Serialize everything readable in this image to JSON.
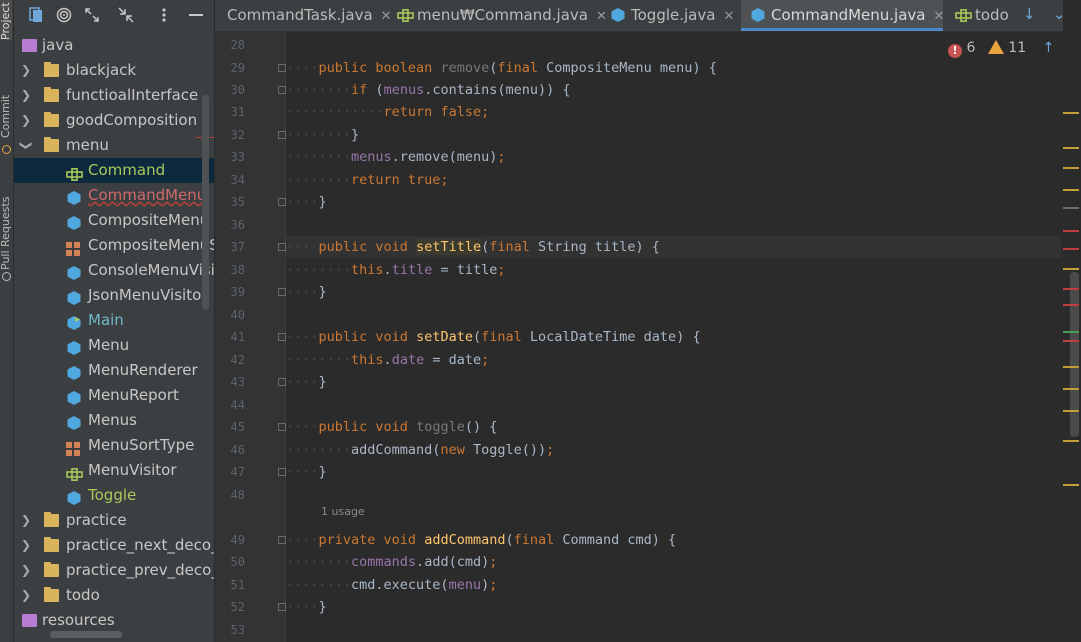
{
  "left_strip": {
    "items": [
      {
        "label": "Project",
        "active": true
      },
      {
        "label": "Commit",
        "active": false
      },
      {
        "label": "Pull Requests",
        "active": false
      }
    ]
  },
  "project_panel": {
    "toolbar": {
      "icons": [
        "project-files-icon",
        "target-icon",
        "expand-icon",
        "collapse-icon",
        "options-icon",
        "hide-icon"
      ]
    },
    "tree": [
      {
        "label": "java",
        "level": 0,
        "type": "source-folder",
        "expanded": true
      },
      {
        "label": "blackjack",
        "level": 1,
        "type": "folder",
        "expanded": false
      },
      {
        "label": "functioalInterface",
        "level": 1,
        "type": "folder",
        "expanded": false
      },
      {
        "label": "goodComposition",
        "level": 1,
        "type": "folder",
        "expanded": false
      },
      {
        "label": "menu",
        "level": 1,
        "type": "folder",
        "expanded": true
      },
      {
        "label": "Command",
        "level": 2,
        "type": "interface",
        "selected": true,
        "style": "green"
      },
      {
        "label": "CommandMenu",
        "level": 2,
        "type": "class",
        "style": "red"
      },
      {
        "label": "CompositeMenu",
        "level": 2,
        "type": "class"
      },
      {
        "label": "CompositeMenuSc",
        "level": 2,
        "type": "enum"
      },
      {
        "label": "ConsoleMenuVisito",
        "level": 2,
        "type": "class"
      },
      {
        "label": "JsonMenuVisitor",
        "level": 2,
        "type": "class"
      },
      {
        "label": "Main",
        "level": 2,
        "type": "main-class",
        "style": "teal"
      },
      {
        "label": "Menu",
        "level": 2,
        "type": "class"
      },
      {
        "label": "MenuRenderer",
        "level": 2,
        "type": "class"
      },
      {
        "label": "MenuReport",
        "level": 2,
        "type": "class"
      },
      {
        "label": "Menus",
        "level": 2,
        "type": "class"
      },
      {
        "label": "MenuSortType",
        "level": 2,
        "type": "enum"
      },
      {
        "label": "MenuVisitor",
        "level": 2,
        "type": "interface"
      },
      {
        "label": "Toggle",
        "level": 2,
        "type": "class",
        "style": "green"
      },
      {
        "label": "practice",
        "level": 1,
        "type": "folder",
        "expanded": false
      },
      {
        "label": "practice_next_deco_fo",
        "level": 1,
        "type": "folder",
        "expanded": false
      },
      {
        "label": "practice_prev_deco_fo",
        "level": 1,
        "type": "folder",
        "expanded": false
      },
      {
        "label": "todo",
        "level": 1,
        "type": "folder",
        "expanded": false
      },
      {
        "label": "resources",
        "level": 0,
        "type": "resources-folder",
        "expanded": false
      }
    ]
  },
  "tabs": [
    {
      "label": "CommandTask.java",
      "icon": "none",
      "active": false
    },
    {
      "label": "menu₩Command.java",
      "icon": "interface-icon",
      "active": false
    },
    {
      "label": "Toggle.java",
      "icon": "class-icon",
      "active": false
    },
    {
      "label": "CommandMenu.java",
      "icon": "class-icon",
      "active": true
    },
    {
      "label": "todo",
      "icon": "interface-icon",
      "active": false
    }
  ],
  "inspections": {
    "errors": "6",
    "warnings": "11"
  },
  "editor": {
    "lines": [
      {
        "n": "28",
        "code": []
      },
      {
        "n": "29",
        "code": [
          [
            "dots",
            "····"
          ],
          [
            "kw",
            "public boolean "
          ],
          [
            "mute",
            "remove"
          ],
          [
            "",
            "("
          ],
          [
            "kw",
            "final "
          ],
          [
            "",
            "CompositeMenu menu) {"
          ]
        ]
      },
      {
        "n": "30",
        "code": [
          [
            "dots",
            "········"
          ],
          [
            "kw",
            "if "
          ],
          [
            "",
            "("
          ],
          [
            "fld",
            "menus"
          ],
          [
            "",
            ".contains(menu)) {"
          ]
        ]
      },
      {
        "n": "31",
        "code": [
          [
            "dots",
            "············"
          ],
          [
            "kw",
            "return false;"
          ]
        ]
      },
      {
        "n": "32",
        "code": [
          [
            "dots",
            "········"
          ],
          [
            "",
            "}"
          ]
        ]
      },
      {
        "n": "33",
        "code": [
          [
            "dots",
            "········"
          ],
          [
            "fld",
            "menus"
          ],
          [
            "",
            ".remove(menu)"
          ],
          [
            "kw",
            ";"
          ]
        ]
      },
      {
        "n": "34",
        "code": [
          [
            "dots",
            "········"
          ],
          [
            "kw",
            "return true;"
          ]
        ]
      },
      {
        "n": "35",
        "code": [
          [
            "dots",
            "····"
          ],
          [
            "",
            "}"
          ]
        ]
      },
      {
        "n": "36",
        "code": []
      },
      {
        "n": "37",
        "code": [
          [
            "dots",
            "····"
          ],
          [
            "kw",
            "public void "
          ],
          [
            "fnhl",
            "setTitle"
          ],
          [
            "",
            "("
          ],
          [
            "kw",
            "final "
          ],
          [
            "",
            "String title) {"
          ]
        ],
        "caret": true
      },
      {
        "n": "38",
        "code": [
          [
            "dots",
            "········"
          ],
          [
            "kw",
            "this"
          ],
          [
            "",
            "."
          ],
          [
            "fld",
            "title"
          ],
          [
            "",
            " = title"
          ],
          [
            "kw",
            ";"
          ]
        ]
      },
      {
        "n": "39",
        "code": [
          [
            "dots",
            "····"
          ],
          [
            "",
            "}"
          ]
        ]
      },
      {
        "n": "40",
        "code": []
      },
      {
        "n": "41",
        "code": [
          [
            "dots",
            "····"
          ],
          [
            "kw",
            "public void "
          ],
          [
            "fn",
            "setDate"
          ],
          [
            "",
            "("
          ],
          [
            "kw",
            "final "
          ],
          [
            "",
            "LocalDateTime date) {"
          ]
        ]
      },
      {
        "n": "42",
        "code": [
          [
            "dots",
            "········"
          ],
          [
            "kw",
            "this"
          ],
          [
            "",
            "."
          ],
          [
            "fld",
            "date"
          ],
          [
            "",
            " = date"
          ],
          [
            "kw",
            ";"
          ]
        ]
      },
      {
        "n": "43",
        "code": [
          [
            "dots",
            "····"
          ],
          [
            "",
            "}"
          ]
        ]
      },
      {
        "n": "44",
        "code": []
      },
      {
        "n": "45",
        "code": [
          [
            "dots",
            "····"
          ],
          [
            "kw",
            "public void "
          ],
          [
            "mute",
            "toggle"
          ],
          [
            "",
            "() {"
          ]
        ]
      },
      {
        "n": "46",
        "code": [
          [
            "dots",
            "········"
          ],
          [
            "",
            "addCommand("
          ],
          [
            "kw",
            "new "
          ],
          [
            "",
            "Toggle())"
          ],
          [
            "kw",
            ";"
          ]
        ]
      },
      {
        "n": "47",
        "code": [
          [
            "dots",
            "····"
          ],
          [
            "",
            "}"
          ]
        ]
      },
      {
        "n": "48",
        "code": []
      },
      {
        "n": "49",
        "code": [
          [
            "dots",
            "····"
          ],
          [
            "kw",
            "private void "
          ],
          [
            "fn",
            "addCommand"
          ],
          [
            "",
            "("
          ],
          [
            "kw",
            "final "
          ],
          [
            "",
            "Command cmd) {"
          ]
        ],
        "usage": "1 usage"
      },
      {
        "n": "50",
        "code": [
          [
            "dots",
            "········"
          ],
          [
            "fld",
            "commands"
          ],
          [
            "",
            ".add(cmd)"
          ],
          [
            "kw",
            ";"
          ]
        ]
      },
      {
        "n": "51",
        "code": [
          [
            "dots",
            "········"
          ],
          [
            "",
            "cmd.execute("
          ],
          [
            "fld",
            "menu"
          ],
          [
            "",
            ")"
          ],
          [
            "kw",
            ";"
          ]
        ]
      },
      {
        "n": "52",
        "code": [
          [
            "dots",
            "····"
          ],
          [
            "",
            "}"
          ]
        ]
      },
      {
        "n": "53",
        "code": []
      }
    ]
  },
  "colors": {
    "accent": "#4a88c7",
    "error": "#c75450",
    "warning": "#e8a33d"
  }
}
